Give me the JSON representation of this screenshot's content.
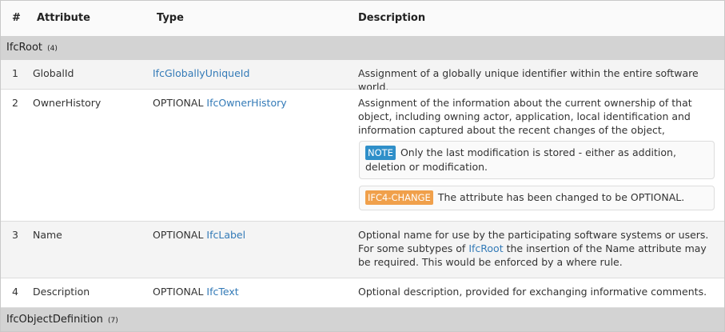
{
  "columns": {
    "num": "#",
    "attribute": "Attribute",
    "type": "Type",
    "description": "Description"
  },
  "groups": [
    {
      "name": "IfcRoot",
      "count": "(4)"
    },
    {
      "name": "IfcObjectDefinition",
      "count": "(7)"
    }
  ],
  "rows": [
    {
      "num": "1",
      "attribute": "GlobalId",
      "type_prefix": "",
      "type_link": "IfcGloballyUniqueId",
      "description": "Assignment of a globally unique identifier within the entire software world."
    },
    {
      "num": "2",
      "attribute": "OwnerHistory",
      "type_prefix": "OPTIONAL",
      "type_link": "IfcOwnerHistory",
      "description": "Assignment of the information about the current ownership of that object, including owning actor, application, local identification and information captured about the recent changes of the object,",
      "note_badge": "NOTE",
      "note_text": "Only the last modification is stored - either as addition, deletion or modification.",
      "change_badge": "IFC4-CHANGE",
      "change_text": "The attribute has been changed to be OPTIONAL."
    },
    {
      "num": "3",
      "attribute": "Name",
      "type_prefix": "OPTIONAL",
      "type_link": "IfcLabel",
      "description_before": "Optional name for use by the participating software systems or users. For some subtypes of",
      "description_link": "IfcRoot",
      "description_after": "the insertion of the Name attribute may be required. This would be enforced by a where rule."
    },
    {
      "num": "4",
      "attribute": "Description",
      "type_prefix": "OPTIONAL",
      "type_link": "IfcText",
      "description": "Optional description, provided for exchanging informative comments."
    }
  ],
  "colors": {
    "link": "#337ab7",
    "group_bg": "#d3d3d3",
    "note_badge": "#2f8fc9",
    "change_badge": "#f0a04b"
  }
}
